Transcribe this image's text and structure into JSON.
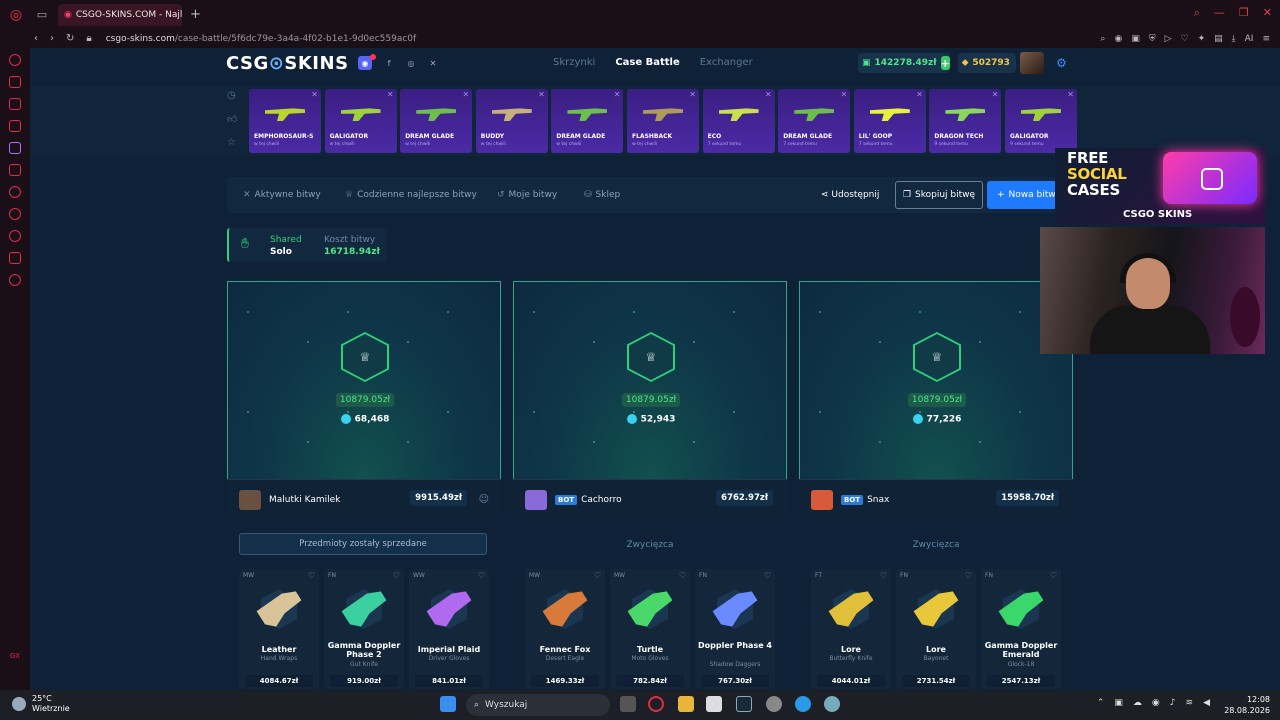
{
  "browser": {
    "tab_title": "CSGO-SKINS.COM - Najlep",
    "url_host": "csgo-skins.com",
    "url_path": "/case-battle/5f6dc79e-3a4a-4f02-b1e1-9d0ec559ac0f",
    "ai_label": "AI"
  },
  "header": {
    "logo_left": "CSG",
    "logo_right": "SKINS",
    "nav": [
      "Skrzynki",
      "Case Battle",
      "Exchanger"
    ],
    "balance": "142278.49zł",
    "coins": "502793"
  },
  "live_drops": [
    {
      "name": "EMPHOROSAUR-S",
      "sub": "w tej chwili",
      "color": "#b7d82a"
    },
    {
      "name": "GALIGATOR",
      "sub": "w tej chwili",
      "color": "#9ed43a"
    },
    {
      "name": "DREAM GLADE",
      "sub": "w tej chwili",
      "color": "#6cc04a"
    },
    {
      "name": "BUDDY",
      "sub": "w tej chwili",
      "color": "#c8b07a"
    },
    {
      "name": "DREAM GLADE",
      "sub": "w tej chwili",
      "color": "#6cc04a"
    },
    {
      "name": "FLASHBACK",
      "sub": "w tej chwili",
      "color": "#b09a5a"
    },
    {
      "name": "ECO",
      "sub": "7 sekund temu",
      "color": "#c8e04a"
    },
    {
      "name": "DREAM GLADE",
      "sub": "7 sekund temu",
      "color": "#6cc04a"
    },
    {
      "name": "LIL' GOOP",
      "sub": "7 sekund temu",
      "color": "#e8f03a"
    },
    {
      "name": "DRAGON TECH",
      "sub": "9 sekund temu",
      "color": "#8ad85a"
    },
    {
      "name": "GALIGATOR",
      "sub": "9 sekund temu",
      "color": "#9ed43a"
    }
  ],
  "battle_tabs": {
    "active": "Aktywne bitwy",
    "daily": "Codzienne najlepsze bitwy",
    "mine": "Moje bitwy",
    "shop": "Sklep",
    "share": "Udostępnij",
    "copy": "Skopiuj bitwę",
    "new": "Nowa bitwa"
  },
  "battle_info": {
    "mode_line1": "Shared",
    "mode_line2": "Solo",
    "cost_label": "Koszt bitwy",
    "cost_value": "16718.94zł"
  },
  "players": [
    {
      "prize": "10879.05zł",
      "gems": "68,468",
      "name": "Malutki Kamilek",
      "bot": "",
      "value": "9915.49zł",
      "avatar_color": "#6a5040",
      "result": "Przedmioty zostały sprzedane",
      "items": [
        {
          "cond": "MW",
          "name": "Leather",
          "sub": "Hand Wraps",
          "price": "4084.67zł",
          "color": "#d9c49a"
        },
        {
          "cond": "FN",
          "name": "Gamma Doppler Phase 2",
          "sub": "Gut Knife",
          "price": "919.00zł",
          "color": "#3ad0a0"
        },
        {
          "cond": "WW",
          "name": "Imperial Plaid",
          "sub": "Driver Gloves",
          "price": "841.01zł",
          "color": "#b06af0"
        }
      ]
    },
    {
      "prize": "10879.05zł",
      "gems": "52,943",
      "name": "Cachorro",
      "bot": "BOT",
      "value": "6762.97zł",
      "avatar_color": "#8a6ad8",
      "result": "Zwycięzca",
      "items": [
        {
          "cond": "MW",
          "name": "Fennec Fox",
          "sub": "Desert Eagle",
          "price": "1469.33zł",
          "color": "#d87a3a"
        },
        {
          "cond": "MW",
          "name": "Turtle",
          "sub": "Moto Gloves",
          "price": "782.84zł",
          "color": "#4ad86a"
        },
        {
          "cond": "FN",
          "name": "Doppler Phase 4",
          "sub": "Shadow Daggers",
          "price": "767.30zł",
          "color": "#6a8aff"
        }
      ]
    },
    {
      "prize": "10879.05zł",
      "gems": "77,226",
      "name": "Snax",
      "bot": "BOT",
      "value": "15958.70zł",
      "avatar_color": "#d85a3a",
      "result": "Zwycięzca",
      "items": [
        {
          "cond": "FT",
          "name": "Lore",
          "sub": "Butterfly Knife",
          "price": "4044.01zł",
          "color": "#e0c03a"
        },
        {
          "cond": "FN",
          "name": "Lore",
          "sub": "Bayonet",
          "price": "2731.54zł",
          "color": "#e8c83a"
        },
        {
          "cond": "FN",
          "name": "Gamma Doppler Emerald",
          "sub": "Glock-18",
          "price": "2547.13zł",
          "color": "#3ad86a"
        }
      ]
    }
  ],
  "promo": {
    "line1": "FREE",
    "line2": "SOCIAL",
    "line3": "CASES",
    "brand": "CSGO SKINS"
  },
  "taskbar": {
    "temp": "25°C",
    "weather": "Wietrznie",
    "search": "Wyszukaj",
    "time": "12:08",
    "date": "28.08.2026"
  }
}
